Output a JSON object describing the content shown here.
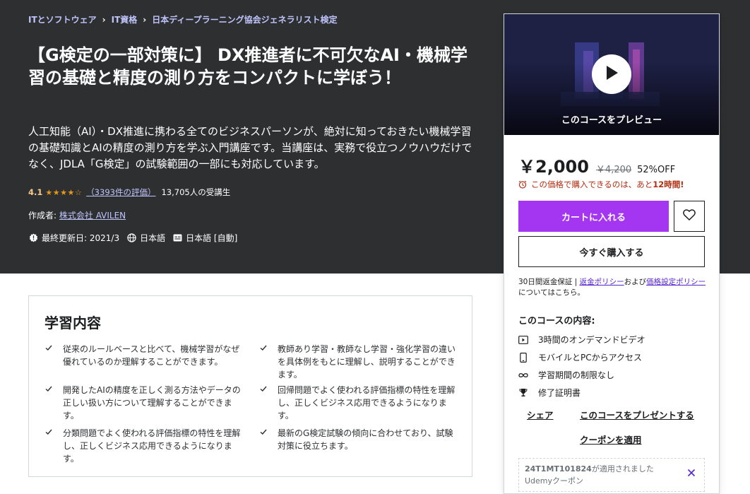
{
  "breadcrumb": [
    "ITとソフトウェア",
    "IT資格",
    "日本ディープラーニング協会ジェネラリスト検定"
  ],
  "course": {
    "title": "【G検定の一部対策に】 DX推進者に不可欠なAI・機械学習の基礎と精度の測り方をコンパクトに学ぼう！",
    "subtitle": "人工知能（AI）・DX推進に携わる全てのビジネスパーソンが、絶対に知っておきたい機械学習の基礎知識とAIの精度の測り方を学ぶ入門講座です。当講座は、実務で役立つノウハウだけでなく、JDLA「G検定」の試験範囲の一部にも対応しています。",
    "rating": "4.1",
    "stars": "★★★★☆",
    "rating_count": "（3393件の評価）",
    "students": "13,705人の受講生",
    "author_label": "作成者:",
    "author": "株式会社 AVILEN",
    "last_updated": "最終更新日: 2021/3",
    "language": "日本語",
    "captions": "日本語 [自動]"
  },
  "learn": {
    "title": "学習内容",
    "items": [
      "従来のルールベースと比べて、機械学習がなぜ優れているのか理解することができます。",
      "教師あり学習・教師なし学習・強化学習の違いを具体例をもとに理解し、説明することができます。",
      "開発したAIの精度を正しく測る方法やデータの正しい扱い方について理解することができます。",
      "回帰問題でよく使われる評価指標の特性を理解し、正しくビジネス応用できるようになります。",
      "分類問題でよく使われる評価指標の特性を理解し、正しくビジネス応用できるようになります。",
      "最新のG検定試験の傾向に合わせており、試験対策に役立ちます。"
    ]
  },
  "sidebar": {
    "preview_label": "このコースをプレビュー",
    "price": "￥2,000",
    "original_price": "￥4,200",
    "discount": "52%OFF",
    "timer_text": "この価格で購入できるのは、あと",
    "timer_hours": "12時間!",
    "cart_button": "カートに入れる",
    "buy_button": "今すぐ購入する",
    "guarantee_prefix": "30日間返金保証 | ",
    "refund_policy": "返金ポリシー",
    "and": "および",
    "pricing_policy": "価格設定ポリシー",
    "guarantee_suffix": "についてはこちら。",
    "includes_title": "このコースの内容:",
    "includes": [
      "3時間のオンデマンドビデオ",
      "モバイルとPCからアクセス",
      "学習期間の制限なし",
      "修了証明書"
    ],
    "share": "シェア",
    "gift": "このコースをプレゼントする",
    "apply_coupon": "クーポンを適用",
    "coupon_code": "24T1MT101824",
    "coupon_applied": "が適用されました",
    "coupon_sub": "Udemyクーポン"
  }
}
